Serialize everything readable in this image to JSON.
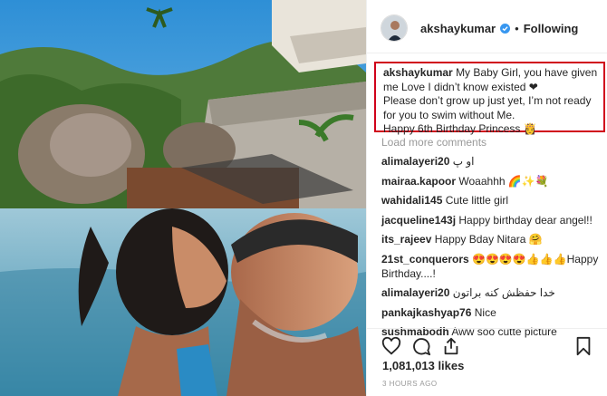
{
  "header": {
    "username": "akshaykumar",
    "separator": "•",
    "follow_label": "Following"
  },
  "caption": {
    "username": "akshaykumar",
    "line1": "My Baby Girl, you have given me Love I didn’t know existed ❤",
    "line2": "Please don’t grow up just yet, I’m not ready for you to swim without Me.",
    "line3": "Happy 6th Birthday Princess 👸"
  },
  "load_more": "Load more comments",
  "comments": [
    {
      "user": "alimalayeri20",
      "text": "او پ"
    },
    {
      "user": "mairaa.kapoor",
      "text": "Woaahhh 🌈✨💐"
    },
    {
      "user": "wahidali145",
      "text": "Cute little girl"
    },
    {
      "user": "jacqueline143j",
      "text": "Happy birthday dear angel!!"
    },
    {
      "user": "its_rajeev",
      "text": "Happy Bday Nitara 🤗"
    },
    {
      "user": "21st_conquerors",
      "text": "😍😍😍😍👍👍👍Happy Birthday....!"
    },
    {
      "user": "alimalayeri20",
      "text": "خدا حفظش کنه براتون"
    },
    {
      "user": "pankajkashyap76",
      "text": "Nice"
    },
    {
      "user": "sushmabodh",
      "text": "Aww soo cutte picture"
    }
  ],
  "likes": "1,081,013 likes",
  "timestamp": "3 HOURS AGO",
  "icons": {
    "like": "heart-icon",
    "comment": "comment-icon",
    "share": "share-icon",
    "save": "bookmark-icon",
    "verified": "verified-badge-icon"
  },
  "colors": {
    "highlight_border": "#d0021b",
    "verified_blue": "#3897f0",
    "muted_text": "#999999"
  }
}
